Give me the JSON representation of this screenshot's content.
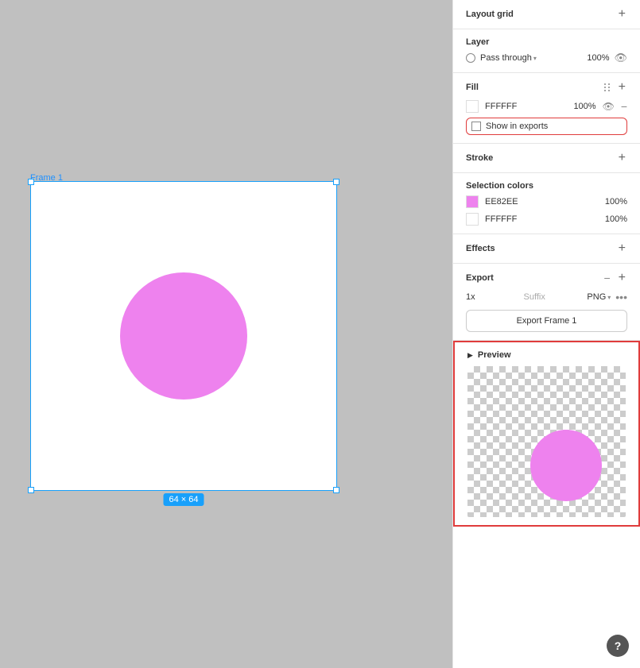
{
  "panel": {
    "layout_grid": {
      "title": "Layout grid",
      "add_icon": "+"
    },
    "layer": {
      "title": "Layer",
      "blend_mode": "Pass through",
      "opacity": "100%"
    },
    "fill": {
      "title": "Fill",
      "color": "FFFFFF",
      "opacity": "100%",
      "show_in_exports": "Show in exports"
    },
    "stroke": {
      "title": "Stroke",
      "add_icon": "+"
    },
    "selection_colors": {
      "title": "Selection colors",
      "colors": [
        {
          "hex": "EE82EE",
          "opacity": "100%",
          "color": "#ee82ee"
        },
        {
          "hex": "FFFFFF",
          "opacity": "100%",
          "color": "#ffffff"
        }
      ]
    },
    "effects": {
      "title": "Effects",
      "add_icon": "+"
    },
    "export": {
      "title": "Export",
      "scale": "1x",
      "suffix_placeholder": "Suffix",
      "format": "PNG",
      "button_label": "Export Frame 1",
      "minus": "−",
      "add": "+"
    },
    "preview": {
      "title": "Preview"
    }
  },
  "canvas": {
    "frame_label": "Frame 1",
    "size_label": "64 × 64"
  }
}
